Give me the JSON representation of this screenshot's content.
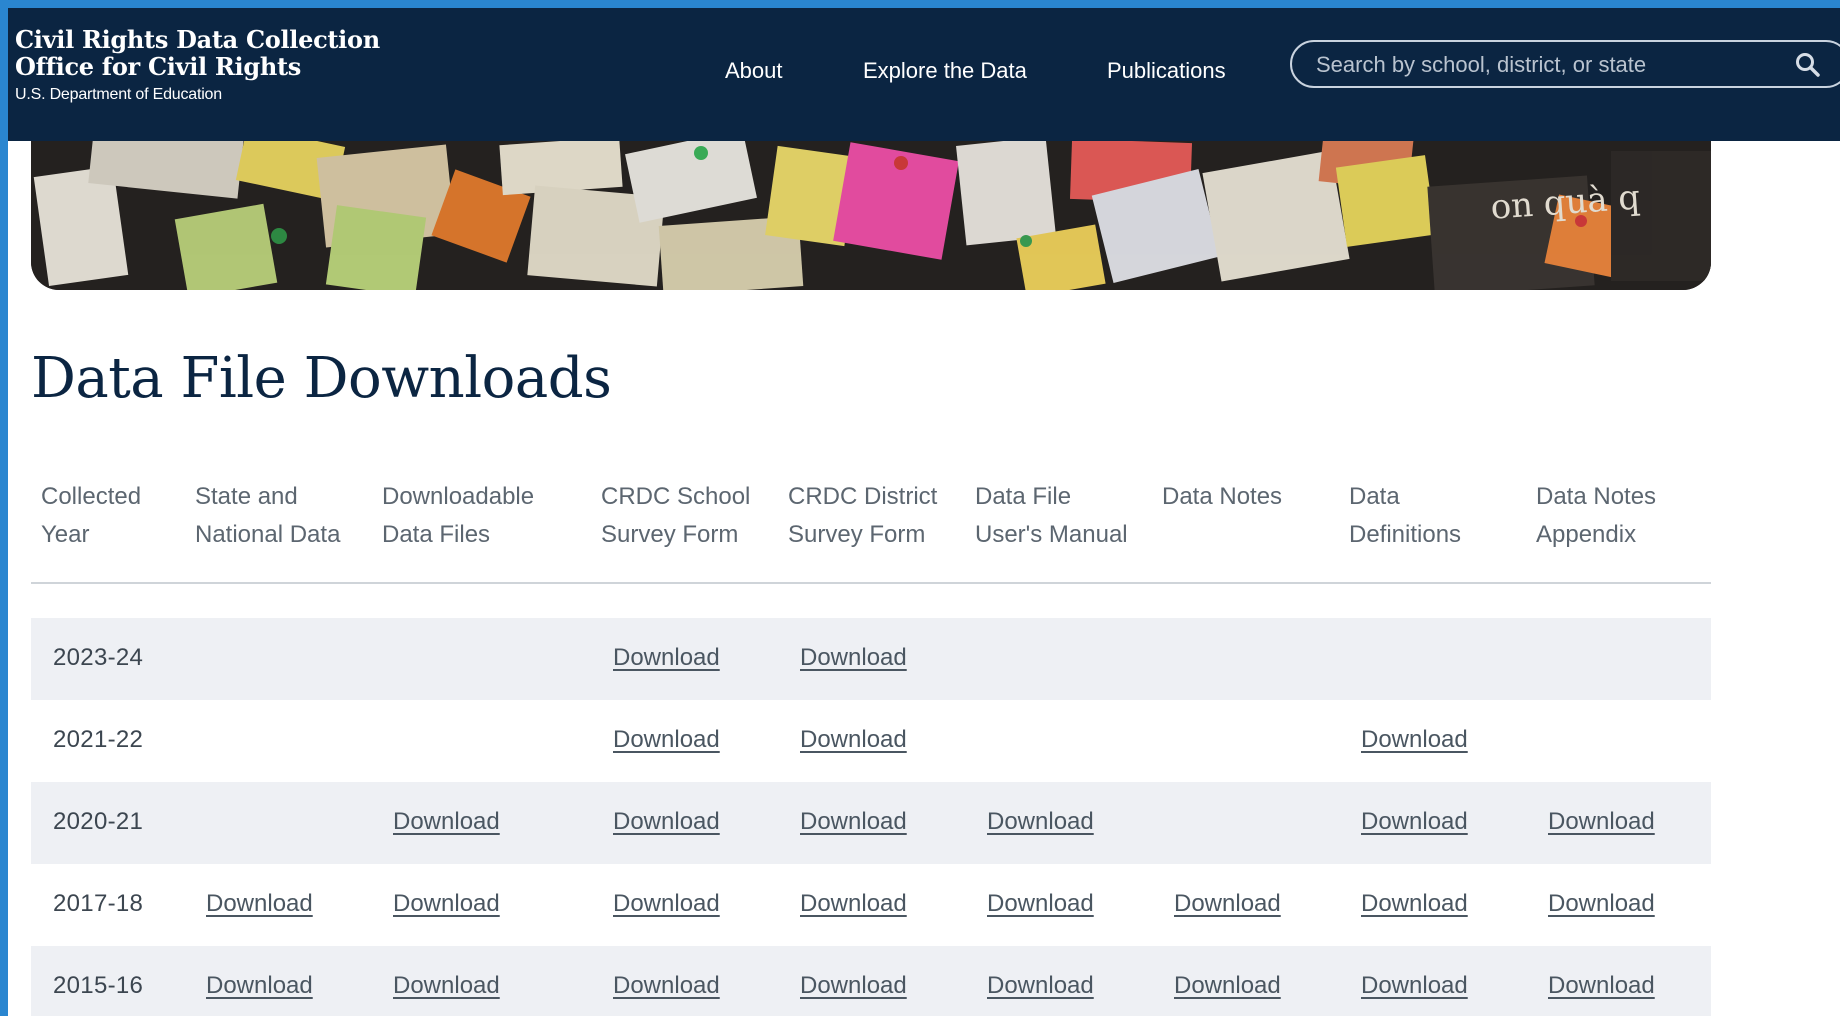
{
  "header": {
    "org_line1": "Civil Rights Data Collection",
    "org_line2": "Office for Civil Rights",
    "dept": "U.S. Department of Education",
    "nav": [
      "About",
      "Explore the Data",
      "Publications"
    ],
    "search_placeholder": "Search by school, district, or state",
    "search_icon": "search-icon"
  },
  "page": {
    "title": "Data File Downloads"
  },
  "table": {
    "columns": [
      "Collected Year",
      "State and National Data",
      "Downloadable Data Files",
      "CRDC School Survey Form",
      "CRDC District Survey Form",
      "Data File User's Manual",
      "Data Notes",
      "Data Definitions",
      "Data Notes Appendix"
    ],
    "link_label": "Download",
    "rows": [
      {
        "year": "2023-24",
        "links": [
          false,
          false,
          true,
          true,
          false,
          false,
          false,
          false
        ]
      },
      {
        "year": "2021-22",
        "links": [
          false,
          false,
          true,
          true,
          false,
          false,
          true,
          false
        ]
      },
      {
        "year": "2020-21",
        "links": [
          false,
          true,
          true,
          true,
          true,
          false,
          true,
          true
        ]
      },
      {
        "year": "2017-18",
        "links": [
          true,
          true,
          true,
          true,
          true,
          true,
          true,
          true
        ]
      },
      {
        "year": "2015-16",
        "links": [
          true,
          true,
          true,
          true,
          true,
          true,
          true,
          true
        ]
      }
    ]
  },
  "colors": {
    "header_bg": "#0b2542",
    "alt_row_bg": "#eef0f4",
    "title": "#0b2542"
  }
}
